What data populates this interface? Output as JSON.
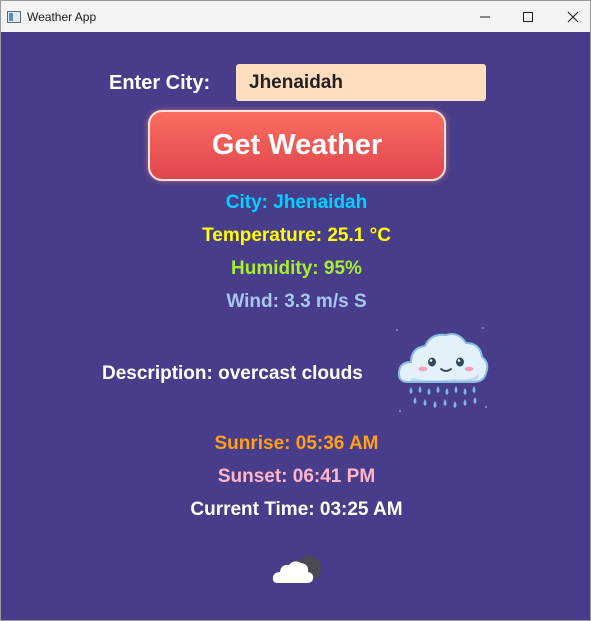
{
  "window": {
    "title": "Weather App",
    "app_icon": "window-app-icon",
    "controls": [
      "minimize-icon",
      "maximize-icon",
      "close-icon"
    ]
  },
  "search": {
    "label": "Enter City:",
    "value": "Jhenaidah",
    "button_label": "Get Weather"
  },
  "weather": {
    "city": "City: Jhenaidah",
    "temperature": "Temperature: 25.1 °C",
    "humidity": "Humidity: 95%",
    "wind": "Wind: 3.3 m/s S",
    "description": "Description: overcast clouds",
    "description_icon": "rain-cloud-icon",
    "sunrise": "Sunrise: 05:36 AM",
    "sunset": "Sunset: 06:41 PM",
    "current_time": "Current Time: 03:25 AM",
    "bottom_icon": "overcast-cloud-icon"
  },
  "colors": {
    "background": "#483d8b",
    "input_background": "#ffdec0",
    "button": "#e8525a",
    "city": "#00d2ff",
    "temperature": "#ffff00",
    "humidity": "#a6f02e",
    "wind": "#a9c6ef",
    "sunrise": "#ff9f1a",
    "sunset": "#ffb6c8"
  }
}
